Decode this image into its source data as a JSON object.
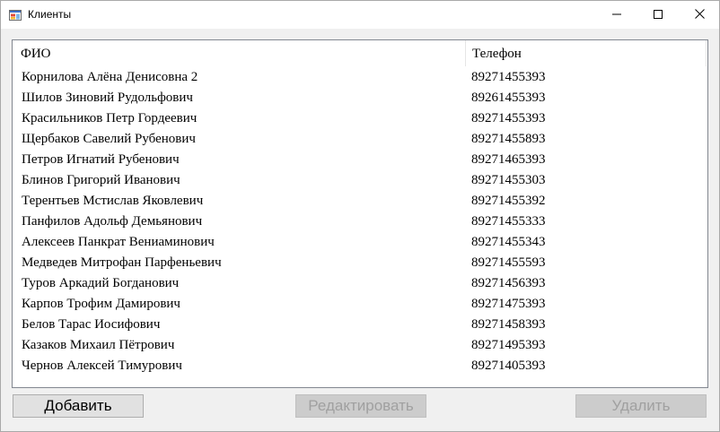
{
  "window": {
    "title": "Клиенты",
    "icon": "windows-form-icon",
    "controls": {
      "minimize": "minimize-icon",
      "maximize": "maximize-icon",
      "close": "close-icon"
    }
  },
  "grid": {
    "columns": [
      "ФИО",
      "Телефон"
    ],
    "rows": [
      {
        "name": "Корнилова Алёна Денисовна 2",
        "phone": "89271455393"
      },
      {
        "name": "Шилов Зиновий Рудольфович",
        "phone": "89261455393"
      },
      {
        "name": "Красильников Петр Гордеевич",
        "phone": "89271455393"
      },
      {
        "name": "Щербаков Савелий Рубенович",
        "phone": "89271455893"
      },
      {
        "name": "Петров Игнатий Рубенович",
        "phone": "89271465393"
      },
      {
        "name": "Блинов Григорий Иванович",
        "phone": "89271455303"
      },
      {
        "name": "Терентьев Мстислав Яковлевич",
        "phone": "89271455392"
      },
      {
        "name": "Панфилов Адольф Демьянович",
        "phone": "89271455333"
      },
      {
        "name": "Алексеев Панкрат Вениаминович",
        "phone": "89271455343"
      },
      {
        "name": "Медведев Митрофан Парфеньевич",
        "phone": "89271455593"
      },
      {
        "name": "Туров Аркадий Богданович",
        "phone": "89271456393"
      },
      {
        "name": "Карпов Трофим Дамирович",
        "phone": "89271475393"
      },
      {
        "name": "Белов Тарас Иосифович",
        "phone": "89271458393"
      },
      {
        "name": "Казаков Михаил Пётрович",
        "phone": "89271495393"
      },
      {
        "name": "Чернов Алексей Тимурович",
        "phone": "89271405393"
      }
    ]
  },
  "buttons": {
    "add": {
      "label": "Добавить",
      "enabled": true
    },
    "edit": {
      "label": "Редактировать",
      "enabled": false
    },
    "delete": {
      "label": "Удалить",
      "enabled": false
    }
  },
  "colors": {
    "window_bg": "#f0f0f0",
    "grid_bg": "#ffffff",
    "grid_border": "#828790",
    "button_enabled_bg": "#e1e1e1",
    "button_disabled_bg": "#cccccc",
    "button_disabled_text": "#a0a0a0"
  }
}
